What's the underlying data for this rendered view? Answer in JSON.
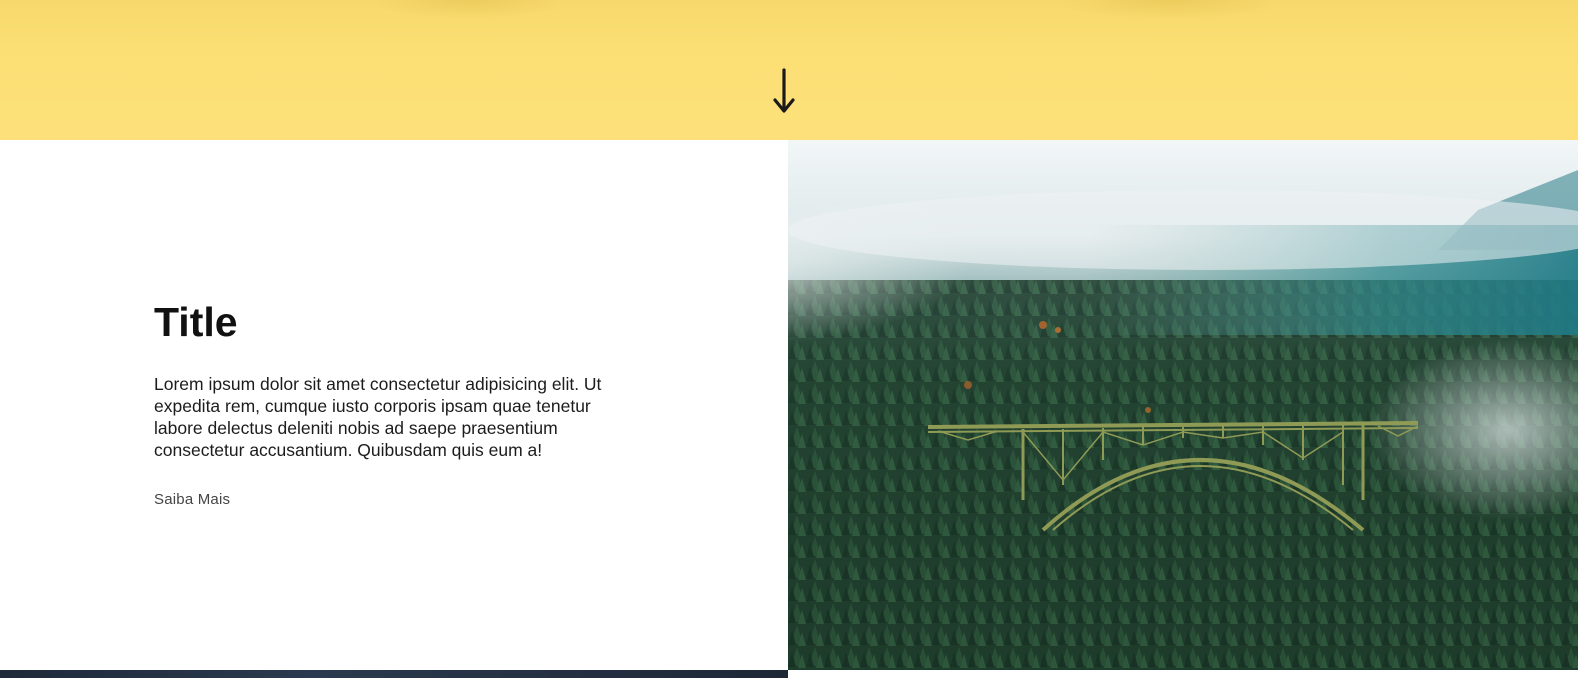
{
  "hero": {
    "background_color": "#fde07a",
    "scroll_icon": "arrow-down-icon"
  },
  "feature": {
    "title": "Title",
    "body": "Lorem ipsum dolor sit amet consectetur adipisicing elit. Ut expedita rem, cumque iusto corporis ipsam quae tenetur labore delectus deleniti nobis ad saepe praesentium consectetur accusantium. Quibusdam quis eum a!",
    "link_label": "Saiba Mais",
    "image_subject": "bridge-over-foggy-forest-photo"
  },
  "colors": {
    "accent_yellow": "#fde07a",
    "text_dark": "#111111",
    "forest_green": "#1f3a2b"
  }
}
